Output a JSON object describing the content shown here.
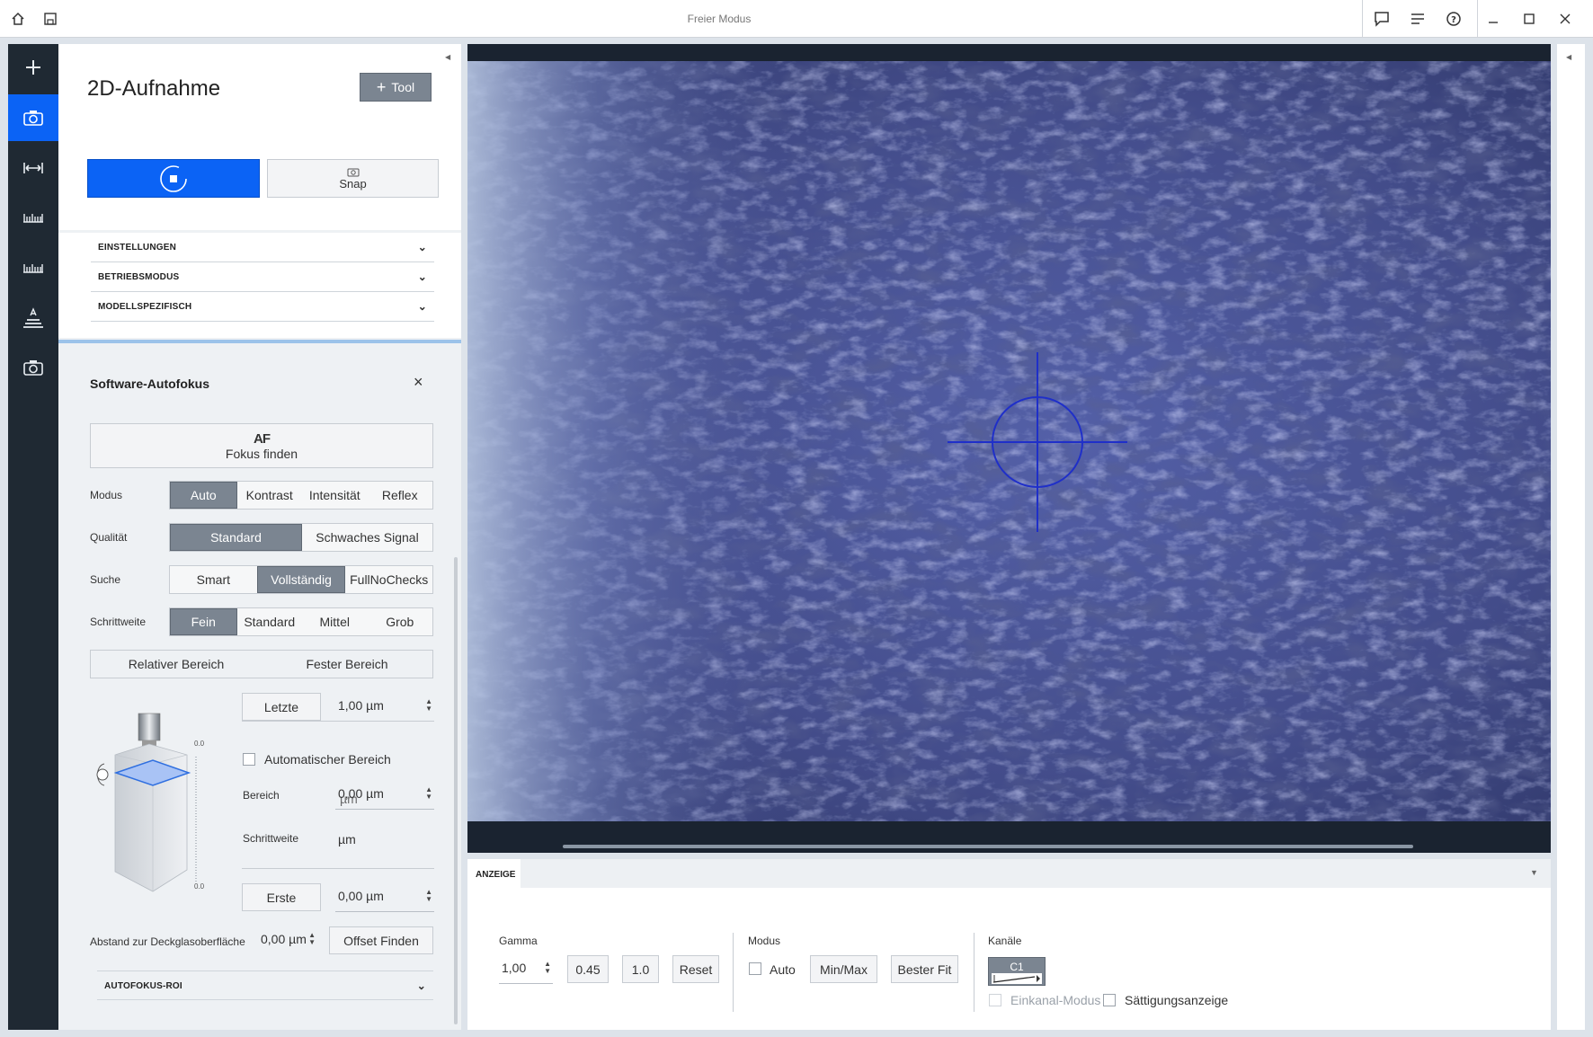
{
  "window": {
    "title": "Freier Modus"
  },
  "panel": {
    "title": "2D-Aufnahme",
    "tool_label": "Tool",
    "snap_label": "Snap",
    "sections": [
      "EINSTELLUNGEN",
      "BETRIEBSMODUS",
      "MODELLSPEZIFISCH"
    ]
  },
  "autofocus": {
    "title": "Software-Autofokus",
    "af_glyph": "AF",
    "find_focus_label": "Fokus finden",
    "modus": {
      "label": "Modus",
      "options": [
        "Auto",
        "Kontrast",
        "Intensität",
        "Reflex"
      ],
      "selected": "Auto"
    },
    "qualitaet": {
      "label": "Qualität",
      "options": [
        "Standard",
        "Schwaches Signal"
      ],
      "selected": "Standard"
    },
    "suche": {
      "label": "Suche",
      "options": [
        "Smart",
        "Vollständig",
        "FullNoChecks"
      ],
      "selected": "Vollständig"
    },
    "schrittweite": {
      "label": "Schrittweite",
      "options": [
        "Fein",
        "Standard",
        "Mittel",
        "Grob"
      ],
      "selected": "Fein"
    },
    "range_tabs": [
      "Relativer Bereich",
      "Fester Bereich"
    ],
    "last_label": "Letzte",
    "last_value": "1,00 µm",
    "auto_range_label": "Automatischer Bereich",
    "bereich_label": "Bereich",
    "bereich_value": "0,00 µm",
    "bereich_overlay": "µm",
    "schritt_label": "Schrittweite",
    "schritt_unit": "µm",
    "first_label": "Erste",
    "first_value": "0,00 µm",
    "scale_top": "0.0",
    "scale_bottom": "0.0",
    "cover_label": "Abstand zur Deckglasoberfläche",
    "cover_value": "0,00 µm",
    "offset_label": "Offset Finden",
    "roi_label": "AUTOFOKUS-ROI"
  },
  "display": {
    "tab": "ANZEIGE",
    "gamma_label": "Gamma",
    "gamma_value": "1,00",
    "gamma_presets": [
      "0.45",
      "1.0"
    ],
    "reset_label": "Reset",
    "modus_label": "Modus",
    "auto_label": "Auto",
    "minmax_label": "Min/Max",
    "bestfit_label": "Bester Fit",
    "channels_label": "Kanäle",
    "channel": "C1",
    "single_channel_label": "Einkanal-Modus",
    "saturation_label": "Sättigungsanzeige"
  },
  "colors": {
    "accent": "#0b63f5",
    "nav": "#1f2933",
    "selected": "#7b8591"
  }
}
